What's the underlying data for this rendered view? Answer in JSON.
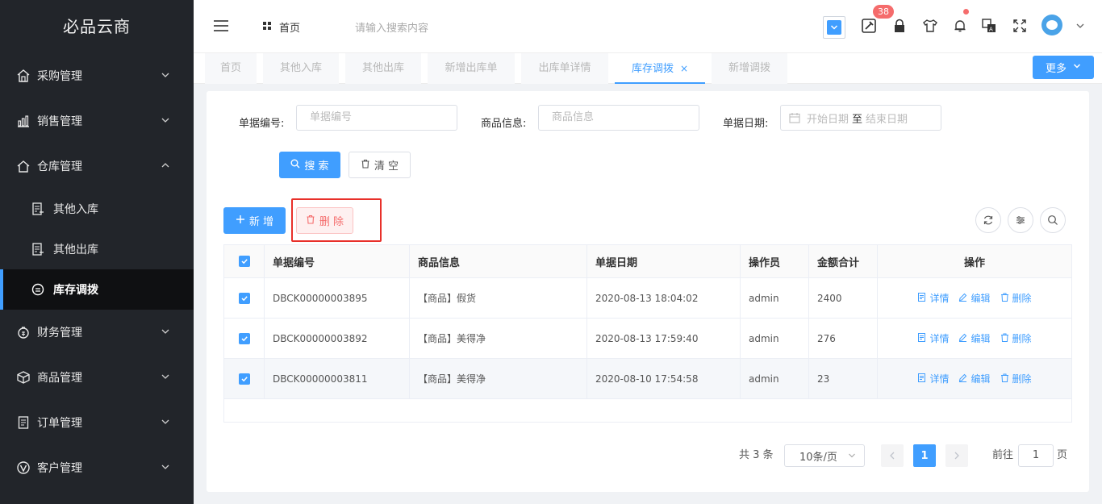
{
  "sidebar": {
    "brand": "必品云商",
    "items": [
      {
        "label": "采购管理",
        "icon": "warehouse-icon"
      },
      {
        "label": "销售管理",
        "icon": "chart-icon"
      },
      {
        "label": "仓库管理",
        "icon": "home-icon"
      },
      {
        "label": "财务管理",
        "icon": "money-bag-icon"
      },
      {
        "label": "商品管理",
        "icon": "box-icon"
      },
      {
        "label": "订单管理",
        "icon": "document-icon"
      },
      {
        "label": "客户管理",
        "icon": "vip-icon"
      }
    ],
    "sub_items": [
      {
        "label": "其他入库",
        "icon": "form-icon"
      },
      {
        "label": "其他出库",
        "icon": "form-icon"
      },
      {
        "label": "库存调拨",
        "icon": "transfer-icon"
      }
    ]
  },
  "header": {
    "home_label": "首页",
    "search_placeholder": "请输入搜索内容",
    "badge_count": "38"
  },
  "tabs": [
    {
      "label": "首页"
    },
    {
      "label": "其他入库"
    },
    {
      "label": "其他出库"
    },
    {
      "label": "新增出库单"
    },
    {
      "label": "出库单详情"
    },
    {
      "label": "库存调拨",
      "close": "×"
    },
    {
      "label": "新增调拨"
    }
  ],
  "more_label": "更多",
  "filters": {
    "doc_no_label": "单据编号:",
    "doc_no_placeholder": "单据编号",
    "goods_label": "商品信息:",
    "goods_placeholder": "商品信息",
    "date_label": "单据日期:",
    "start_placeholder": "开始日期",
    "range_sep": "至",
    "end_placeholder": "结束日期"
  },
  "buttons": {
    "search": "搜 索",
    "clear": "清 空",
    "add": "新 增",
    "delete": "删 除"
  },
  "table": {
    "headers": [
      "单据编号",
      "商品信息",
      "单据日期",
      "操作员",
      "金额合计",
      "操作"
    ],
    "rows": [
      {
        "no": "DBCK00000003895",
        "goods": "【商品】假货",
        "date": "2020-08-13 18:04:02",
        "operator": "admin",
        "amount": "2400"
      },
      {
        "no": "DBCK00000003892",
        "goods": "【商品】美得净",
        "date": "2020-08-13 17:59:40",
        "operator": "admin",
        "amount": "276"
      },
      {
        "no": "DBCK00000003811",
        "goods": "【商品】美得净",
        "date": "2020-08-10 17:54:58",
        "operator": "admin",
        "amount": "23"
      }
    ],
    "ops": {
      "detail": "详情",
      "edit": "编辑",
      "delete": "删除"
    }
  },
  "pagination": {
    "total": "共 3 条",
    "page_size": "10条/页",
    "current": "1",
    "goto_label": "前往",
    "goto_value": "1",
    "page_suffix": "页"
  },
  "colors": {
    "primary": "#409eff",
    "danger": "#f56c6c",
    "sidebar_bg": "#22252a"
  }
}
